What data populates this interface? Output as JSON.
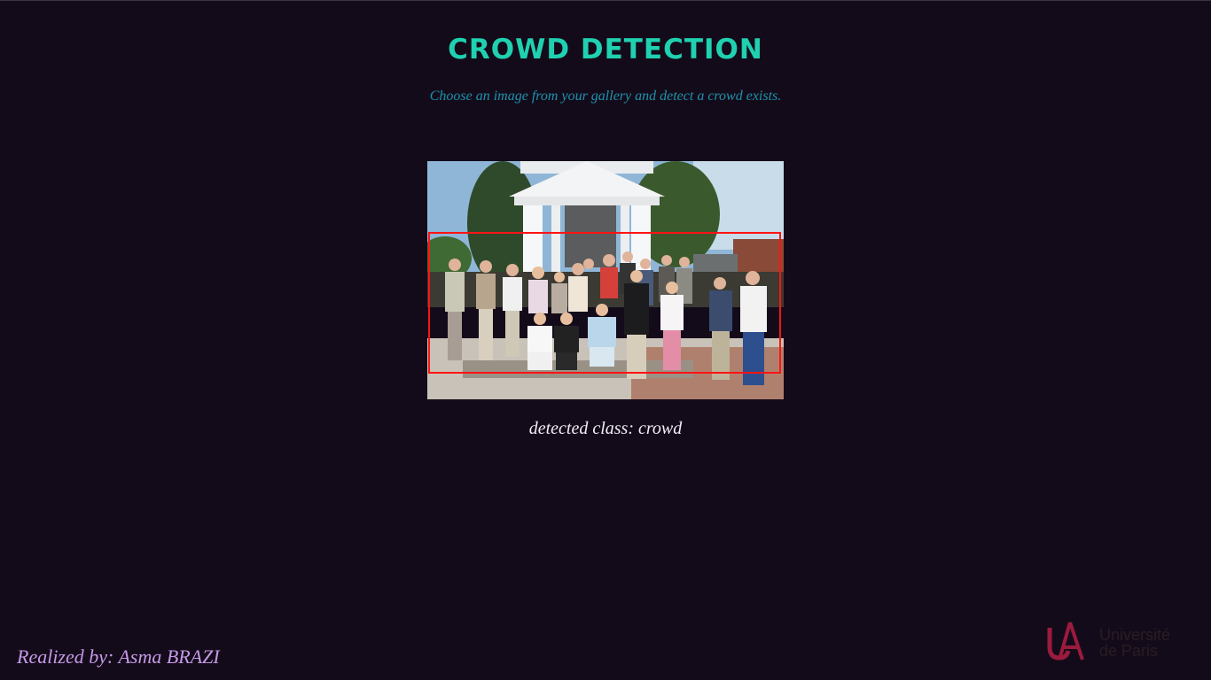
{
  "header": {
    "title": "CROWD DETECTION",
    "subtitle": "Choose an image from your gallery and detect a crowd exists."
  },
  "result": {
    "image_subject": "group photo of people in front of a white monument",
    "bounding_box_color": "#ff1414",
    "detected_label": "detected class: crowd"
  },
  "footer": {
    "credit": "Realized by: Asma BRAZI",
    "logo": {
      "line1": "Université",
      "line2": "de Paris",
      "mark_color": "#9b1b3d"
    }
  },
  "colors": {
    "background": "#140b1a",
    "title": "#1fd1b0",
    "subtitle": "#1c93ad",
    "detected_text": "#f2eef7",
    "credit": "#c59ae6"
  }
}
